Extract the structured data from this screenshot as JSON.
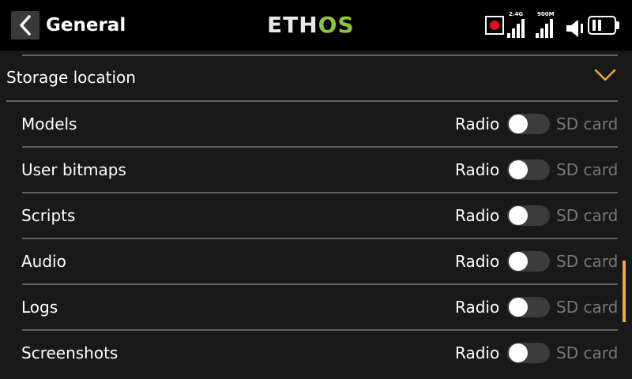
{
  "header": {
    "title": "General",
    "logo_main": "ETH",
    "logo_accent": "OS",
    "signal_labels": [
      "2.4G",
      "900M"
    ]
  },
  "section": {
    "title": "Storage location",
    "expanded": true
  },
  "rows": [
    {
      "label": "Models",
      "option_left": "Radio",
      "option_right": "SD card",
      "selected": "Radio"
    },
    {
      "label": "User bitmaps",
      "option_left": "Radio",
      "option_right": "SD card",
      "selected": "Radio"
    },
    {
      "label": "Scripts",
      "option_left": "Radio",
      "option_right": "SD card",
      "selected": "Radio"
    },
    {
      "label": "Audio",
      "option_left": "Radio",
      "option_right": "SD card",
      "selected": "Radio"
    },
    {
      "label": "Logs",
      "option_left": "Radio",
      "option_right": "SD card",
      "selected": "Radio"
    },
    {
      "label": "Screenshots",
      "option_left": "Radio",
      "option_right": "SD card",
      "selected": "Radio"
    }
  ],
  "colors": {
    "accent": "#f2a92e",
    "logo_green": "#8cc63f",
    "record": "#e0101f",
    "background": "#191919",
    "separator": "#606060"
  },
  "icons": [
    "back-arrow-icon",
    "record-icon",
    "signal-2-4g-icon",
    "signal-900m-icon",
    "speaker-icon",
    "battery-icon",
    "chevron-down-icon"
  ]
}
